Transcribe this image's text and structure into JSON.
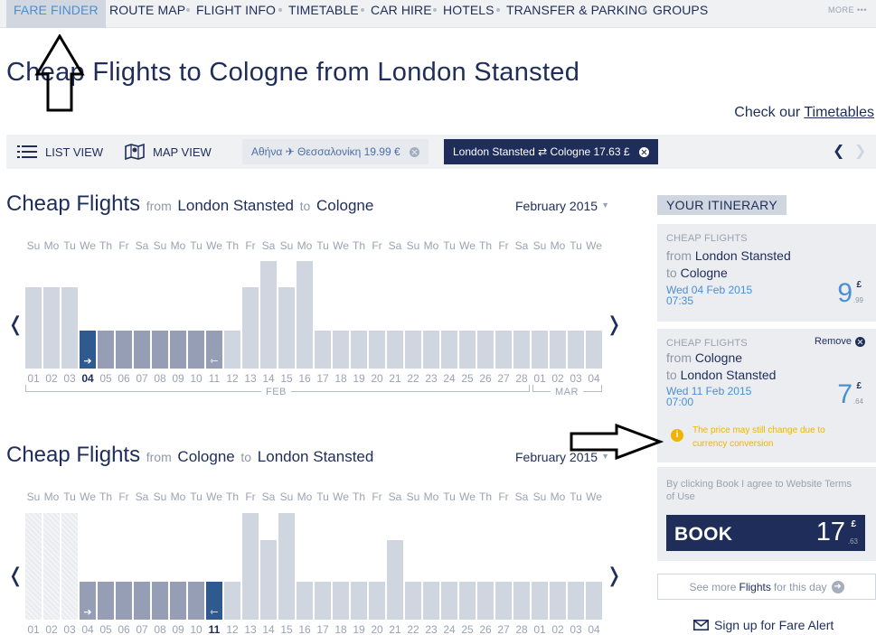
{
  "nav": {
    "items": [
      "FARE FINDER",
      "ROUTE MAP",
      "FLIGHT INFO",
      "TIMETABLE",
      "CAR HIRE",
      "HOTELS",
      "TRANSFER & PARKING",
      "GROUPS"
    ],
    "more": "MORE"
  },
  "page": {
    "title": "Cheap Flights to Cologne from London Stansted",
    "check_prefix": "Check our",
    "check_link": "Timetables"
  },
  "views": {
    "list": "LIST VIEW",
    "map": "MAP VIEW",
    "chip_inactive": "Αθήνα ✈ Θεσσαλονίκη 19.99 €",
    "chip_active": "London Stansted ⇄ Cologne 17.63 £"
  },
  "outbound": {
    "title_main": "Cheap Flights",
    "from_word": "from",
    "from": "London Stansted",
    "to_word": "to",
    "to": "Cologne",
    "month": "February 2015"
  },
  "inbound": {
    "title_main": "Cheap Flights",
    "from_word": "from",
    "from": "Cologne",
    "to_word": "to",
    "to": "London Stansted",
    "month": "February 2015"
  },
  "calendar": {
    "dow": [
      "Su",
      "Mo",
      "Tu",
      "We",
      "Th",
      "Fr",
      "Sa",
      "Su",
      "Mo",
      "Tu",
      "We",
      "Th",
      "Fr",
      "Sa",
      "Su",
      "Mo",
      "Tu",
      "We",
      "Th",
      "Fr",
      "Sa",
      "Su",
      "Mo",
      "Tu",
      "We",
      "Th",
      "Fr",
      "Sa",
      "Su",
      "Mo",
      "Tu",
      "We"
    ],
    "days": [
      "01",
      "02",
      "03",
      "04",
      "05",
      "06",
      "07",
      "08",
      "09",
      "10",
      "11",
      "12",
      "13",
      "14",
      "15",
      "16",
      "17",
      "18",
      "19",
      "20",
      "21",
      "22",
      "23",
      "24",
      "25",
      "26",
      "27",
      "28",
      "01",
      "02",
      "03",
      "04"
    ],
    "month_feb": "FEB",
    "month_mar": "MAR",
    "outbound_levels": [
      3,
      3,
      3,
      2,
      2,
      2,
      2,
      2,
      2,
      2,
      2,
      2,
      3,
      4,
      3,
      4,
      1,
      1,
      1,
      1,
      1,
      1,
      1,
      1,
      1,
      1,
      1,
      1,
      1,
      1,
      1,
      1
    ],
    "inbound_levels": [
      4,
      4,
      4,
      2,
      2,
      2,
      2,
      2,
      2,
      2,
      2,
      2,
      4,
      3,
      4,
      2,
      2,
      2,
      2,
      2,
      3,
      2,
      2,
      2,
      2,
      2,
      2,
      2,
      2,
      2,
      2,
      2
    ]
  },
  "itinerary": {
    "heading": "YOUR ITINERARY",
    "leg1": {
      "label": "CHEAP FLIGHTS",
      "from_word": "from",
      "from": "London Stansted",
      "to_word": "to",
      "to": "Cologne",
      "date": "Wed 04 Feb 2015",
      "time": "07:35",
      "price": "9",
      "currency": "£",
      "cents": ".99"
    },
    "leg2": {
      "label": "CHEAP FLIGHTS",
      "remove": "Remove",
      "from_word": "from",
      "from": "Cologne",
      "to_word": "to",
      "to": "London Stansted",
      "date": "Wed 11 Feb 2015",
      "time": "07:00",
      "price": "7",
      "currency": "£",
      "cents": ".64"
    },
    "warning": "The price may still change due to currency conversion",
    "terms": "By clicking Book I agree to Website Terms of Use",
    "book_label": "BOOK",
    "book_price": "17",
    "book_currency": "£",
    "book_cents": ".63",
    "see_more_prefix": "See more",
    "see_more_bold": "Flights",
    "see_more_suffix": "for this day",
    "fare_alert": "Sign up for Fare Alert"
  },
  "colors": {
    "navy": "#1e2d5a",
    "accent_blue": "#4a8fd6",
    "bar": "#cfd6df",
    "bar_range": "#959eb5",
    "bar_selected": "#2f5a8f",
    "warning": "#f0b400"
  },
  "icons": [
    "list-icon",
    "map-icon",
    "plane-icon",
    "close-icon",
    "chevron-left-icon",
    "chevron-right-icon",
    "info-icon",
    "arrow-right-icon",
    "envelope-icon"
  ]
}
